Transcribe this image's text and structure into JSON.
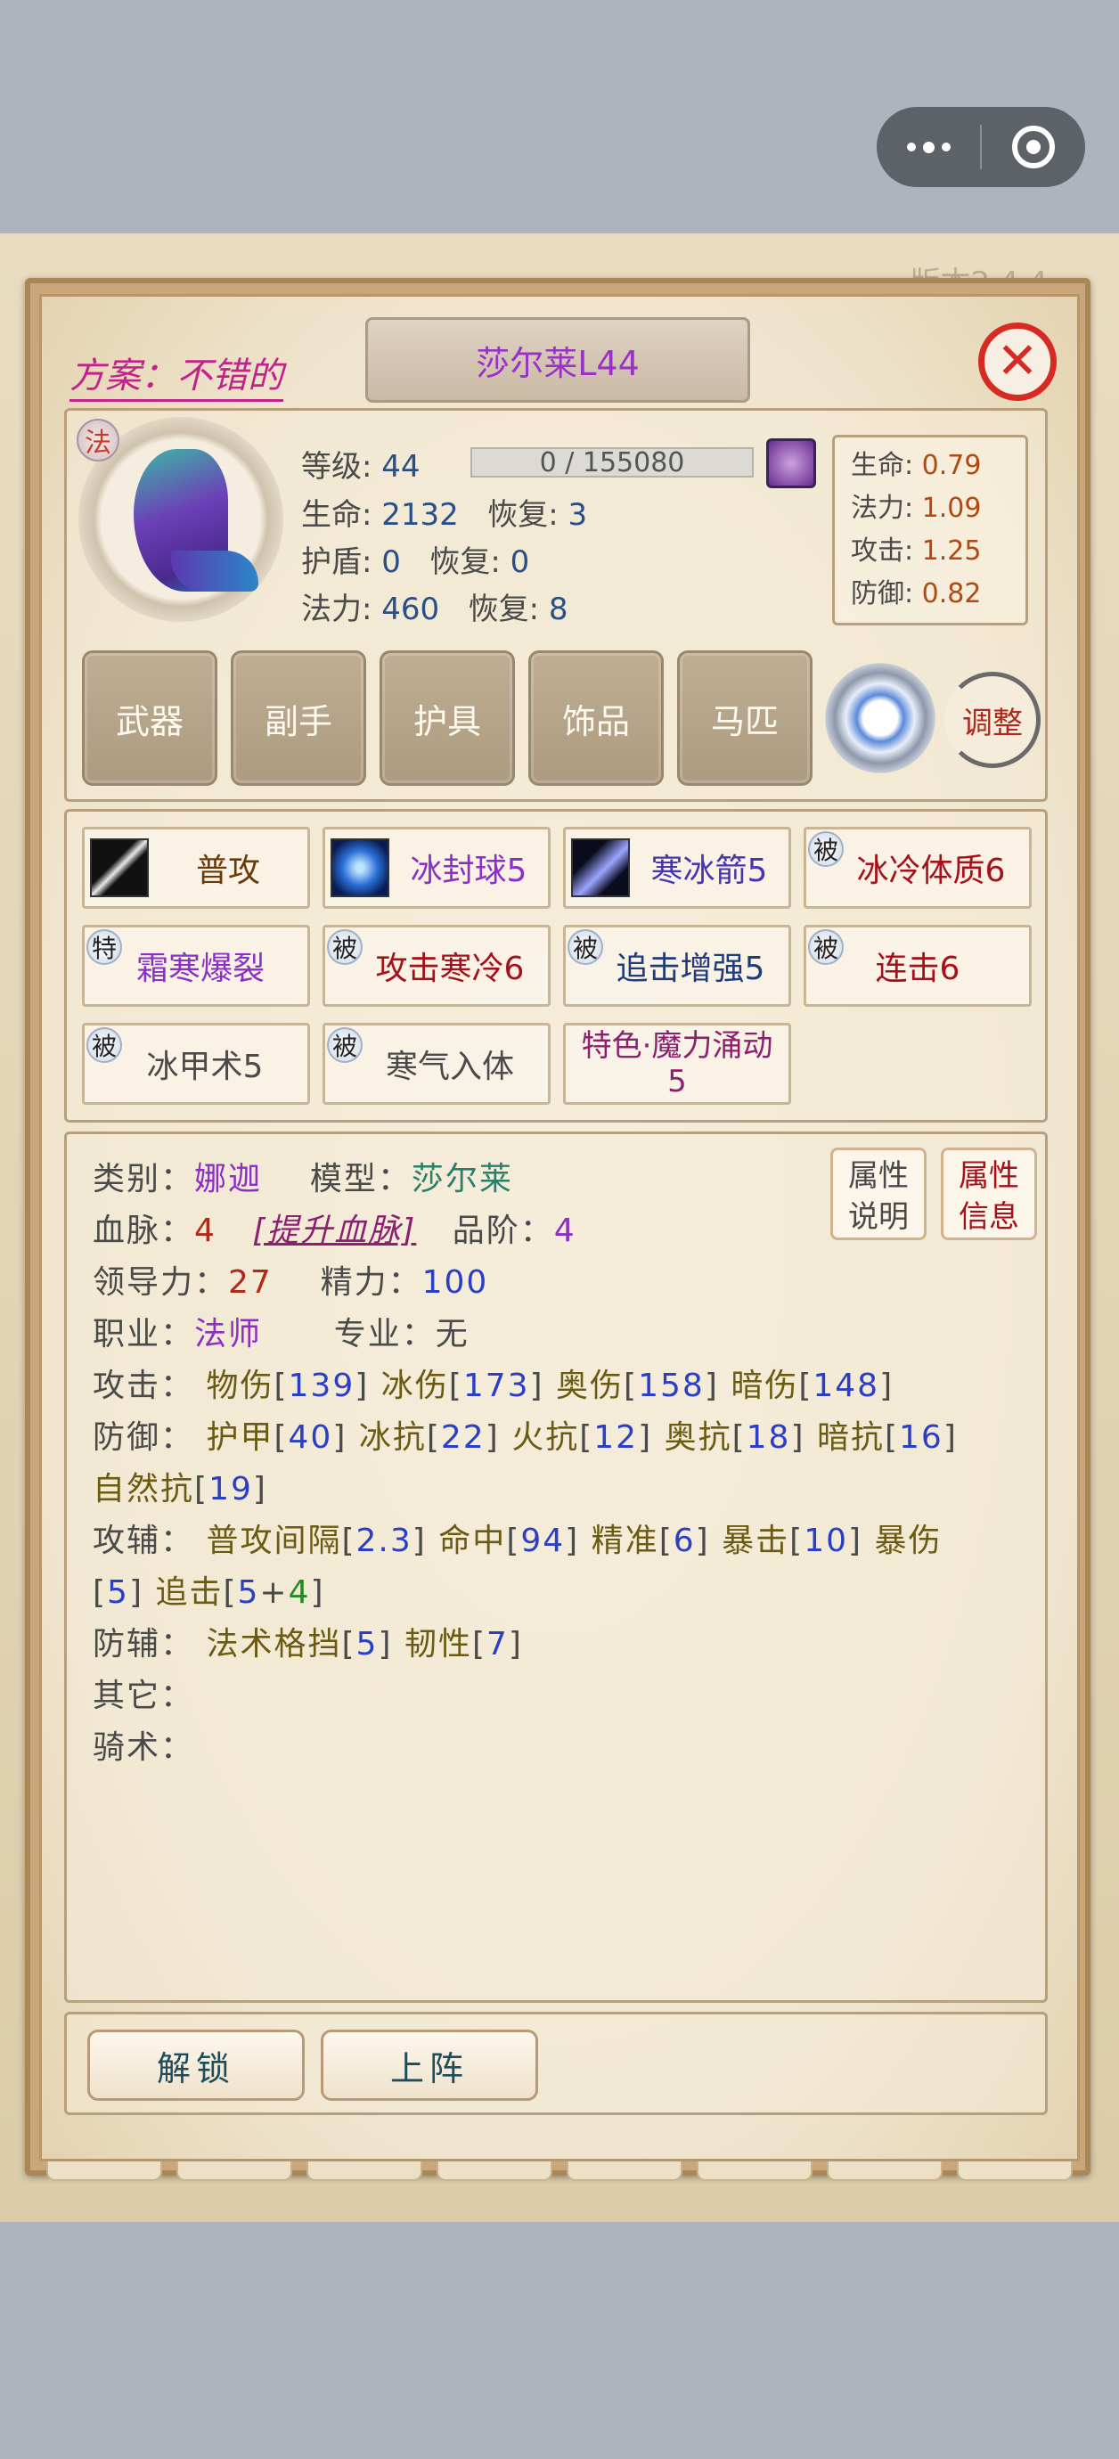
{
  "capsule": {
    "menu_icon": "more-dots-icon",
    "close_icon": "record-circle-icon"
  },
  "header": {
    "version_text": "版本2.4.4",
    "scheme": "方案：不错的",
    "unit_title": "莎尔莱L44",
    "close_icon": "close-icon"
  },
  "unit": {
    "class_badge": "法",
    "level_label": "等级:",
    "level": "44",
    "exp_text": "0 / 155080",
    "hp_label": "生命:",
    "hp": "2132",
    "hp_regen_label": "恢复:",
    "hp_regen": "3",
    "shield_label": "护盾:",
    "shield": "0",
    "shield_regen_label": "恢复:",
    "shield_regen": "0",
    "mp_label": "法力:",
    "mp": "460",
    "mp_regen_label": "恢复:",
    "mp_regen": "8"
  },
  "ratios": {
    "hp_label": "生命:",
    "hp": "0.79",
    "mp_label": "法力:",
    "mp": "1.09",
    "atk_label": "攻击:",
    "atk": "1.25",
    "def_label": "防御:",
    "def": "0.82"
  },
  "equipment": [
    "武器",
    "副手",
    "护具",
    "饰品",
    "马匹"
  ],
  "adjust_label": "调整",
  "skills": [
    {
      "label": "普攻",
      "tag": ""
    },
    {
      "label": "冰封球5",
      "tag": ""
    },
    {
      "label": "寒冰箭5",
      "tag": ""
    },
    {
      "label": "冰冷体质6",
      "tag": "被"
    },
    {
      "label": "霜寒爆裂",
      "tag": "特"
    },
    {
      "label": "攻击寒冷6",
      "tag": "被"
    },
    {
      "label": "追击增强5",
      "tag": "被"
    },
    {
      "label": "连击6",
      "tag": "被"
    },
    {
      "label": "冰甲术5",
      "tag": "被"
    },
    {
      "label": "寒气入体",
      "tag": "被"
    },
    {
      "label": "特色·魔力涌动",
      "label2": "5",
      "tag": ""
    }
  ],
  "attr_buttons": [
    {
      "line1": "属性",
      "line2": "说明"
    },
    {
      "line1": "属性",
      "line2": "信息"
    }
  ],
  "attrs": {
    "type_label": "类别：",
    "type": "娜迦",
    "model_label": "模型：",
    "model": "莎尔莱",
    "blood_label": "血脉：",
    "blood": "4",
    "blood_link": "[提升血脉]",
    "grade_label": "品阶：",
    "grade": "4",
    "lead_label": "领导力：",
    "lead": "27",
    "energy_label": "精力：",
    "energy": "100",
    "job_label": "职业：",
    "job": "法师",
    "spec_label": "专业：",
    "spec": "无",
    "atk_label": "攻击：",
    "atk_items": [
      {
        "k": "物伤",
        "v": "139"
      },
      {
        "k": "冰伤",
        "v": "173"
      },
      {
        "k": "奥伤",
        "v": "158"
      },
      {
        "k": "暗伤",
        "v": "148"
      }
    ],
    "def_label": "防御：",
    "def_items": [
      {
        "k": "护甲",
        "v": "40"
      },
      {
        "k": "冰抗",
        "v": "22"
      },
      {
        "k": "火抗",
        "v": "12"
      },
      {
        "k": "奥抗",
        "v": "18"
      },
      {
        "k": "暗抗",
        "v": "16"
      }
    ],
    "def_items2": [
      {
        "k": "自然抗",
        "v": "19"
      }
    ],
    "aux_atk_label": "攻辅：",
    "aux_atk_items": [
      {
        "k": "普攻间隔",
        "v": "2.3"
      },
      {
        "k": "命中",
        "v": "94"
      },
      {
        "k": "精准",
        "v": "6"
      },
      {
        "k": "暴击",
        "v": "10"
      }
    ],
    "aux_atk_tail": "暴伤",
    "aux_atk_line2_v1": "5",
    "aux_atk_line2_k": "追击",
    "aux_atk_line2_base": "5",
    "aux_atk_line2_plus": "+",
    "aux_atk_line2_bonus": "4",
    "aux_def_label": "防辅：",
    "aux_def_items": [
      {
        "k": "法术格挡",
        "v": "5"
      },
      {
        "k": "韧性",
        "v": "7"
      }
    ],
    "other_label": "其它：",
    "ride_label": "骑术："
  },
  "bottom": {
    "unlock": "解锁",
    "deploy": "上阵"
  }
}
